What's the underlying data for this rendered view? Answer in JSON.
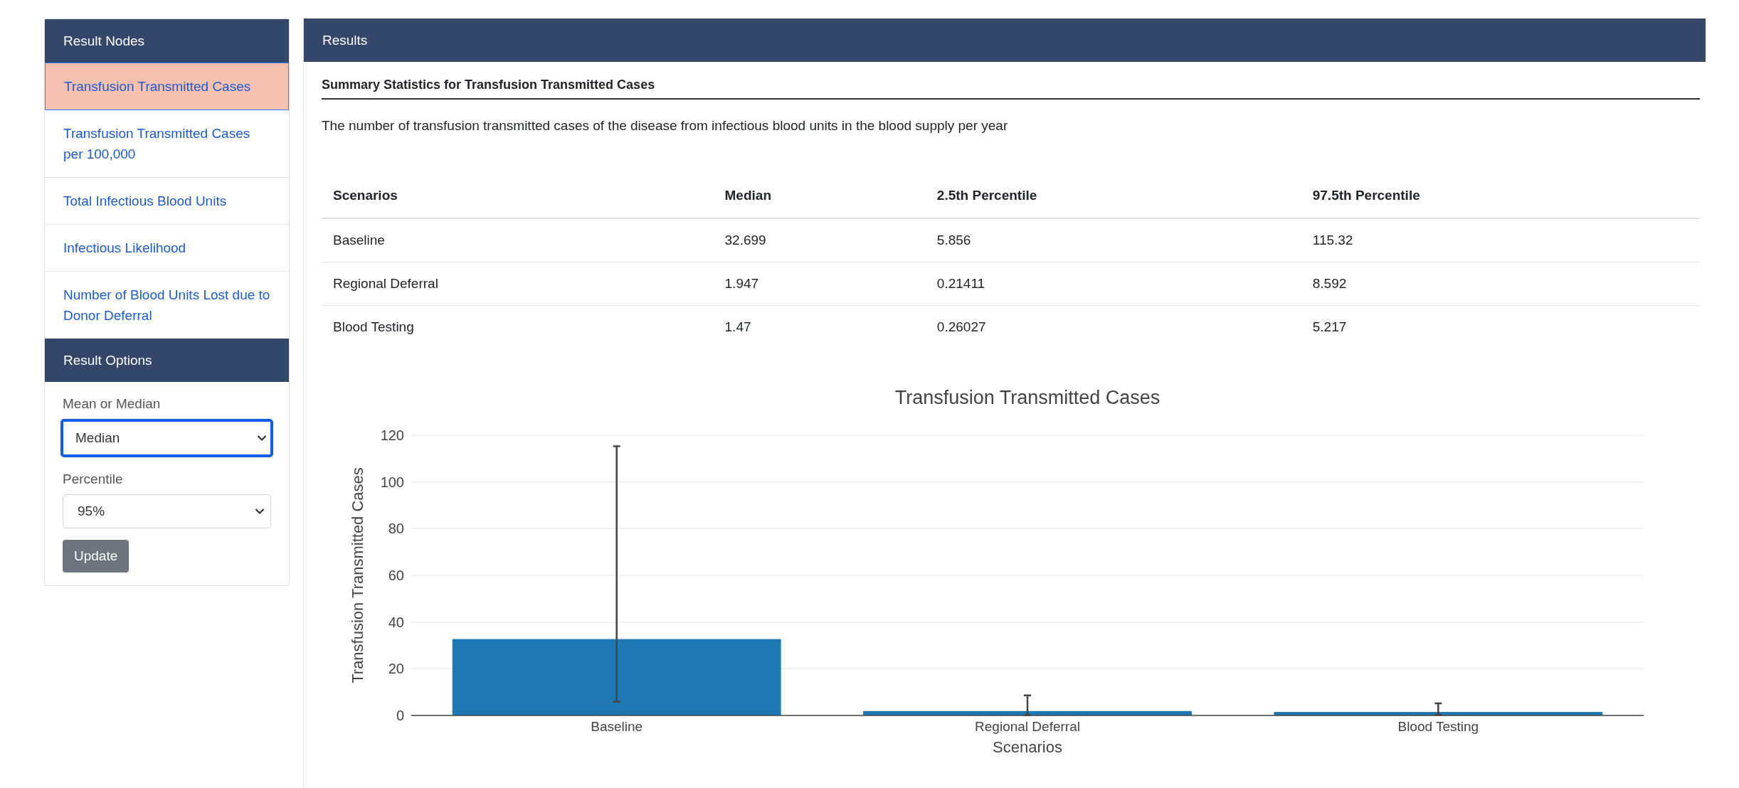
{
  "sidebar": {
    "nodes_header": "Result Nodes",
    "items": [
      {
        "label": "Transfusion Transmitted Cases",
        "selected": true
      },
      {
        "label": "Transfusion Transmitted Cases per 100,000",
        "selected": false
      },
      {
        "label": "Total Infectious Blood Units",
        "selected": false
      },
      {
        "label": "Infectious Likelihood",
        "selected": false
      },
      {
        "label": "Number of Blood Units Lost due to Donor Deferral",
        "selected": false
      }
    ],
    "options_header": "Result Options",
    "fields": [
      {
        "label": "Mean or Median",
        "value": "Median",
        "focused": true
      },
      {
        "label": "Percentile",
        "value": "95%",
        "focused": false
      }
    ],
    "button": "Update"
  },
  "results": {
    "header": "Results",
    "title": "Summary Statistics for Transfusion Transmitted Cases",
    "description": "The number of transfusion transmitted cases of the disease from infectious blood units in the blood supply per year",
    "table": {
      "columns": [
        "Scenarios",
        "Median",
        "2.5th Percentile",
        "97.5th Percentile"
      ],
      "rows": [
        [
          "Baseline",
          "32.699",
          "5.856",
          "115.32"
        ],
        [
          "Regional Deferral",
          "1.947",
          "0.21411",
          "8.592"
        ],
        [
          "Blood Testing",
          "1.47",
          "0.26027",
          "5.217"
        ]
      ]
    },
    "chart_data": {
      "type": "bar",
      "title": "Transfusion Transmitted Cases",
      "xlabel": "Scenarios",
      "ylabel": "Transfusion Transmitted Cases",
      "categories": [
        "Baseline",
        "Regional Deferral",
        "Blood Testing"
      ],
      "series": [
        {
          "color": "#1f77b4",
          "values": [
            32.7,
            1.9,
            1.5
          ],
          "errors": [
            [
              5.9,
              115.3
            ],
            [
              0.2,
              8.6
            ],
            [
              0.3,
              5.2
            ]
          ]
        }
      ],
      "ylim": [
        0,
        120
      ],
      "yticks": [
        0,
        20,
        40,
        60,
        80,
        100,
        120
      ],
      "grid": true
    }
  }
}
